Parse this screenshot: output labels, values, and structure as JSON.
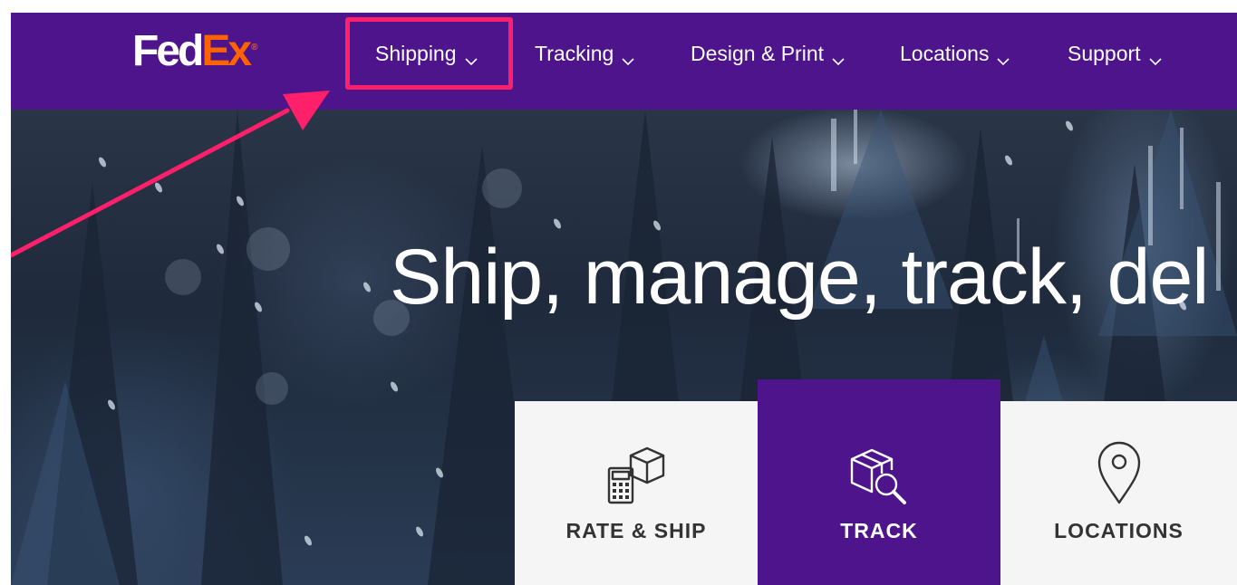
{
  "brand": {
    "logo_fed": "Fed",
    "logo_ex": "Ex",
    "logo_reg": "®",
    "primary_color": "#4d148c",
    "accent_color": "#ff6200",
    "annotation_color": "#ff1f6a"
  },
  "nav": {
    "items": [
      {
        "label": "Shipping",
        "icon": "chevron-down-icon",
        "highlighted": true
      },
      {
        "label": "Tracking",
        "icon": "chevron-down-icon"
      },
      {
        "label": "Design & Print",
        "icon": "chevron-down-icon"
      },
      {
        "label": "Locations",
        "icon": "chevron-down-icon"
      },
      {
        "label": "Support",
        "icon": "chevron-down-icon"
      }
    ]
  },
  "hero": {
    "title": "Ship, manage, track, del"
  },
  "tiles": [
    {
      "label": "RATE & SHIP",
      "icon": "calculator-package-icon"
    },
    {
      "label": "TRACK",
      "icon": "package-magnifier-icon",
      "active": true
    },
    {
      "label": "LOCATIONS",
      "icon": "map-pin-icon"
    }
  ]
}
